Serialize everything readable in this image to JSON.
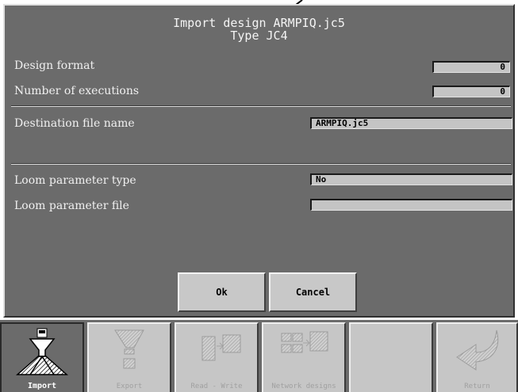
{
  "dialog": {
    "title_line1": "Import design ARMPIQ.jc5",
    "title_line2": "Type JC4",
    "fields": {
      "design_format": {
        "label": "Design format",
        "value": "0"
      },
      "number_of_executions": {
        "label": "Number of executions",
        "value": "0"
      },
      "destination_file_name": {
        "label": "Destination file name",
        "value": "ARMPIQ.jc5"
      },
      "loom_parameter_type": {
        "label": "Loom parameter type",
        "value": "No"
      },
      "loom_parameter_file": {
        "label": "Loom parameter file",
        "value": ""
      }
    },
    "buttons": {
      "ok": "Ok",
      "cancel": "Cancel"
    }
  },
  "toolbar": {
    "items": [
      {
        "label": "Import",
        "icon": "import-icon",
        "state": "active"
      },
      {
        "label": "Export",
        "icon": "export-icon",
        "state": "disabled"
      },
      {
        "label": "Read - Write",
        "icon": "read-write-icon",
        "state": "disabled"
      },
      {
        "label": "Network designs",
        "icon": "network-designs-icon",
        "state": "disabled"
      },
      {
        "label": "",
        "icon": "",
        "state": "empty"
      },
      {
        "label": "Return",
        "icon": "return-arrow-icon",
        "state": "disabled"
      }
    ]
  },
  "colors": {
    "panel_bg": "#6b6b6b",
    "field_bg": "#c4c4c4",
    "button_bg": "#c8c8c8",
    "text_light": "#f0f0f0"
  }
}
